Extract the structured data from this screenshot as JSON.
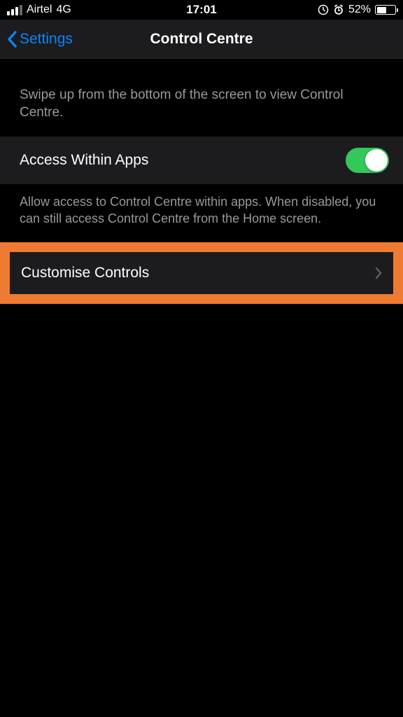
{
  "statusBar": {
    "carrier": "Airtel",
    "network": "4G",
    "time": "17:01",
    "battery": "52%"
  },
  "nav": {
    "back": "Settings",
    "title": "Control Centre"
  },
  "content": {
    "intro": "Swipe up from the bottom of the screen to view Control Centre.",
    "accessRow": {
      "label": "Access Within Apps",
      "enabled": true
    },
    "accessFooter": "Allow access to Control Centre within apps. When disabled, you can still access Control Centre from the Home screen.",
    "customiseLabel": "Customise Controls"
  }
}
